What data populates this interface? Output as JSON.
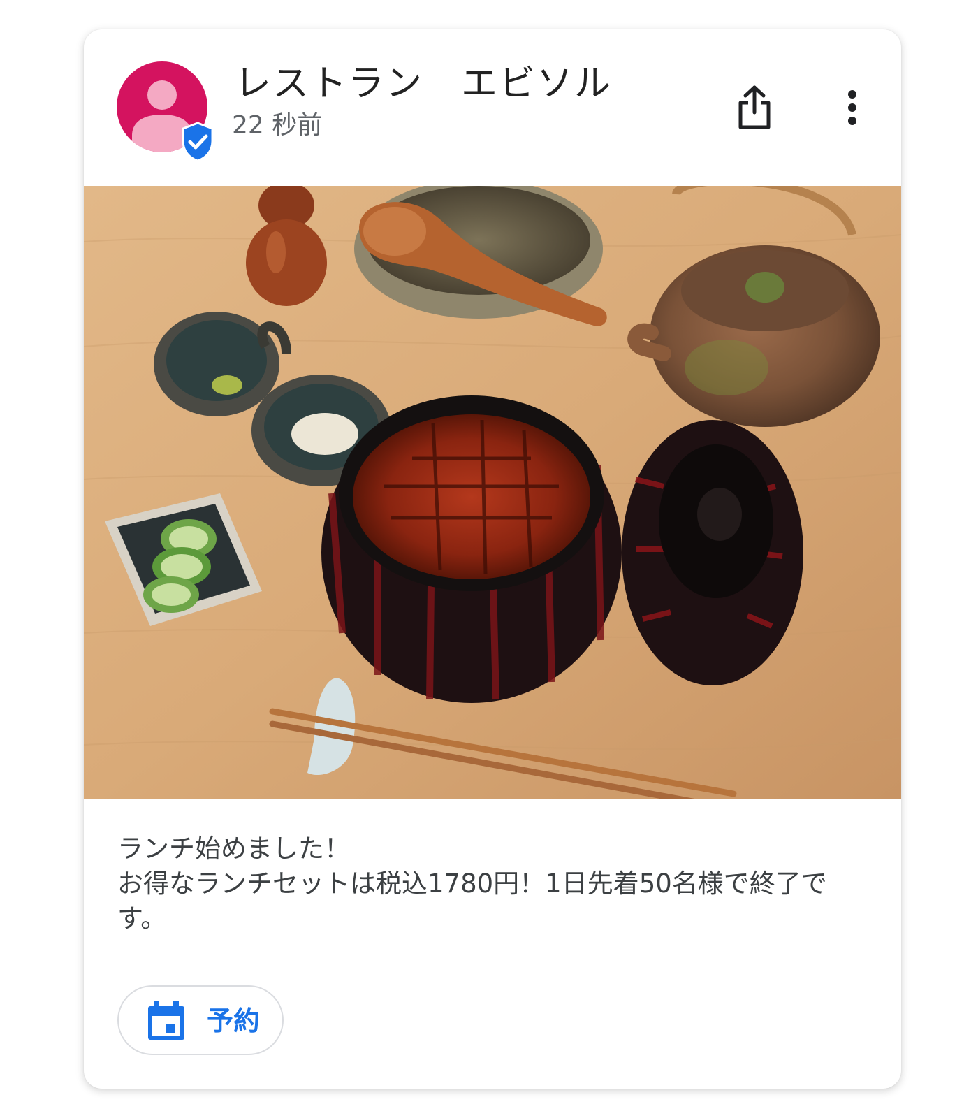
{
  "post": {
    "author": "レストラン　エビソル",
    "time": "22 秒前",
    "text_lines": [
      "ランチ始めました！",
      "お得なランチセットは税込1780円！1日先着50名様で終了で",
      "す。"
    ],
    "reserve_label": "予約"
  },
  "icons": {
    "avatar": "person-avatar-icon",
    "verified": "verified-shield-icon",
    "share": "share-icon",
    "more": "more-vert-icon",
    "calendar": "calendar-icon"
  },
  "colors": {
    "avatar_bg": "#d4135f",
    "avatar_fg": "#f4a9c3",
    "accent": "#1a73e8",
    "title": "#222222",
    "subtext": "#5f6368"
  }
}
